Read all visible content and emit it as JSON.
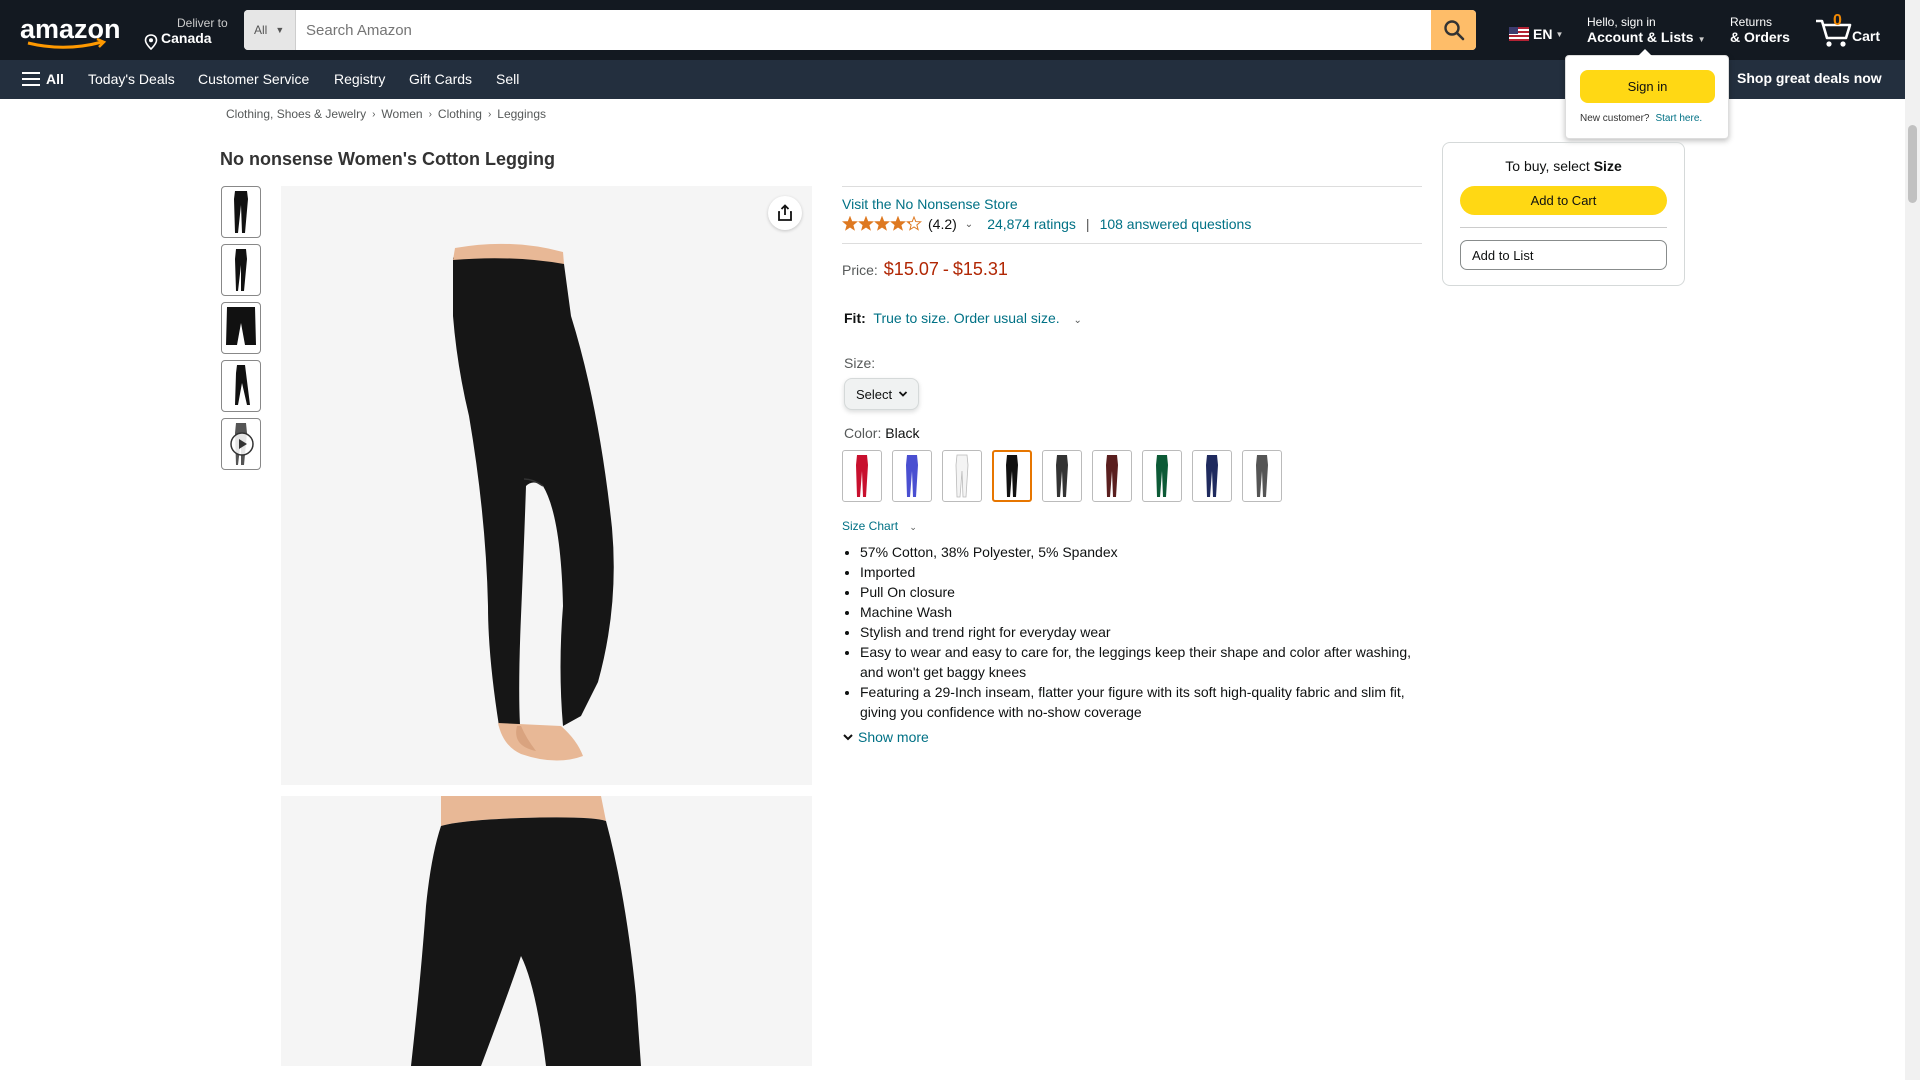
{
  "header": {
    "deliver_line1": "Deliver to",
    "deliver_line2": "Canada",
    "search_dept": "All",
    "search_placeholder": "Search Amazon",
    "language": "EN",
    "account_line1": "Hello, sign in",
    "account_line2": "Account & Lists",
    "returns_line1": "Returns",
    "returns_line2": "& Orders",
    "cart_count": "0",
    "cart_label": "Cart"
  },
  "nav": {
    "all_label": "All",
    "links": [
      "Today's Deals",
      "Customer Service",
      "Registry",
      "Gift Cards",
      "Sell"
    ],
    "promo": "Shop great deals now"
  },
  "flyout": {
    "signin": "Sign in",
    "new_customer": "New customer?",
    "start_here": "Start here."
  },
  "breadcrumb": [
    "Clothing, Shoes & Jewelry",
    "Women",
    "Clothing",
    "Leggings"
  ],
  "product": {
    "title": "No nonsense Women's Cotton Legging",
    "store_link": "Visit the No Nonsense Store",
    "rating_value": 4.2,
    "rating_text": "(4.2)",
    "ratings_count": "24,874 ratings",
    "answered": "108 answered questions",
    "price_label": "Price:",
    "price_low": "$15.07",
    "price_dash": "-",
    "price_high": "$15.31",
    "fit_label": "Fit:",
    "fit_value": "True to size. Order usual size.",
    "size_label": "Size:",
    "size_select": "Select",
    "color_label": "Color:",
    "color_value": "Black",
    "swatch_colors": [
      "#c8102e",
      "#4a4fd1",
      "#f4f4f4",
      "#111111",
      "#333333",
      "#5a1f1f",
      "#0c5a36",
      "#1f2a5e",
      "#555555"
    ],
    "selected_swatch": 3,
    "size_chart": "Size Chart",
    "bullets": [
      "57% Cotton, 38% Polyester, 5% Spandex",
      "Imported",
      "Pull On closure",
      "Machine Wash",
      "Stylish and trend right for everyday wear",
      "Easy to wear and easy to care for, the leggings keep their shape and color after washing, and won't get baggy knees",
      "Featuring a 29-Inch inseam, flatter your figure with its soft high-quality fabric and slim fit, giving you confidence with no-show coverage"
    ],
    "show_more": "Show more"
  },
  "buybox": {
    "head_prefix": "To buy, select",
    "head_bold": "Size",
    "add_to_cart": "Add to Cart",
    "add_to_list": "Add to List"
  },
  "colors": {
    "nav_dark": "#131921",
    "nav_mid": "#232f3e",
    "accent_yellow": "#ffd814",
    "search_orange": "#febd69",
    "price_red": "#b12704",
    "link_teal": "#007185",
    "star_orange": "#de7921"
  }
}
